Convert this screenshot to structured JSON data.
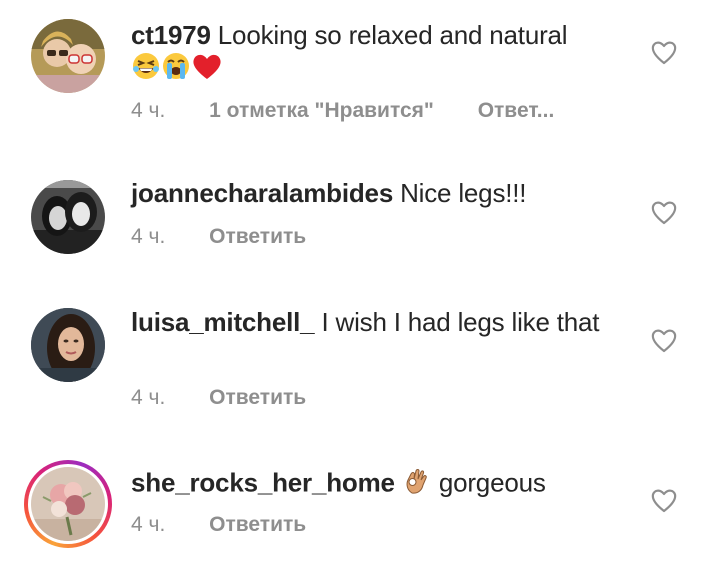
{
  "comments": [
    {
      "username": "ct1979",
      "text": "Looking so relaxed and natural",
      "emojis": [
        "grinning-squinting-face",
        "loudly-crying-face",
        "red-heart"
      ],
      "time": "4 ч.",
      "likes": "1 отметка \"Нравится\"",
      "reply": "Ответ..."
    },
    {
      "username": "joannecharalambides",
      "text": "Nice legs!!!",
      "time": "4 ч.",
      "reply": "Ответить"
    },
    {
      "username": "luisa_mitchell_",
      "text": "I wish I had legs like that",
      "time": "4 ч.",
      "reply": "Ответить"
    },
    {
      "username": "she_rocks_her_home",
      "text": "gorgeous",
      "emojis": [
        "ok-hand"
      ],
      "time": "4 ч.",
      "reply": "Ответить",
      "has_story": true
    }
  ],
  "colors": {
    "text": "#262626",
    "meta": "#8e8e8e",
    "heart_outline": "#8e8e8e",
    "story_ring": [
      "#f9a33a",
      "#d8227a",
      "#9b2cc0"
    ]
  },
  "icons": {
    "like": "heart-outline-icon"
  }
}
